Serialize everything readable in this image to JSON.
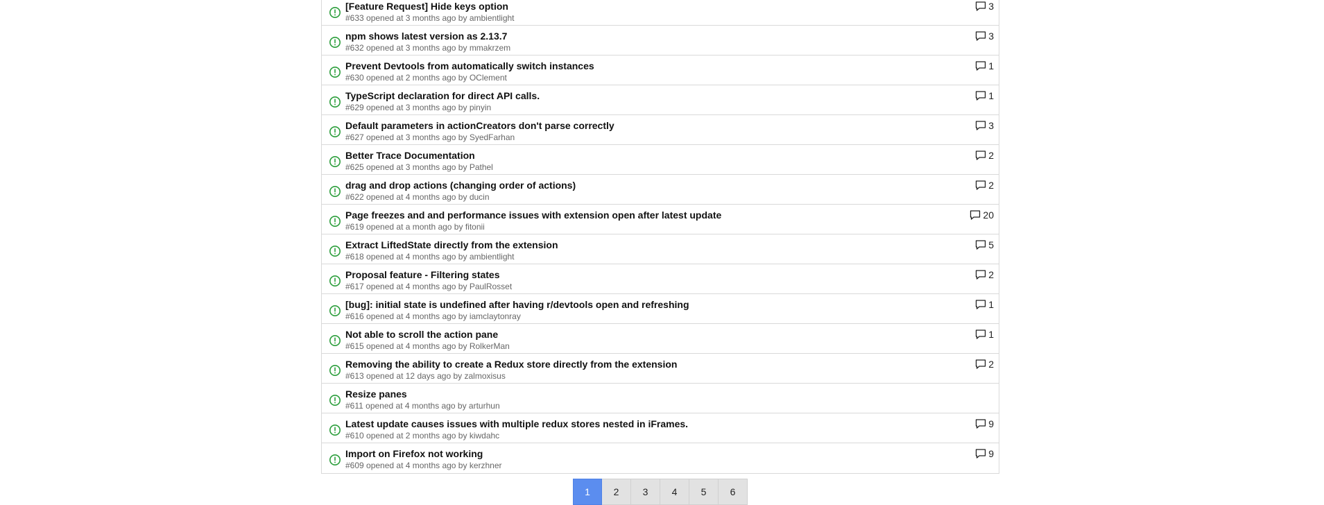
{
  "colors": {
    "open_icon": "#2a9d3a",
    "active_page": "#5b8def",
    "page_bg": "#e2e2e2"
  },
  "icons": {
    "status": "issue-opened-icon",
    "comments": "comment-icon"
  },
  "issues": [
    {
      "title": "[Feature Request] Hide keys option",
      "number": "#633",
      "opened": " opened at 3 months ago by ",
      "author": "ambientlight",
      "comments": "3"
    },
    {
      "title": "npm shows latest version as 2.13.7",
      "number": "#632",
      "opened": " opened at 3 months ago by ",
      "author": "mmakrzem",
      "comments": "3"
    },
    {
      "title": "Prevent Devtools from automatically switch instances",
      "number": "#630",
      "opened": " opened at 2 months ago by ",
      "author": "OClement",
      "comments": "1"
    },
    {
      "title": "TypeScript declaration for direct API calls.",
      "number": "#629",
      "opened": " opened at 3 months ago by ",
      "author": "pinyin",
      "comments": "1"
    },
    {
      "title": "Default parameters in actionCreators don't parse correctly",
      "number": "#627",
      "opened": " opened at 3 months ago by ",
      "author": "SyedFarhan",
      "comments": "3"
    },
    {
      "title": "Better Trace Documentation",
      "number": "#625",
      "opened": " opened at 3 months ago by ",
      "author": "Pathel",
      "comments": "2"
    },
    {
      "title": "drag and drop actions (changing order of actions)",
      "number": "#622",
      "opened": " opened at 4 months ago by ",
      "author": "ducin",
      "comments": "2"
    },
    {
      "title": "Page freezes and and performance issues with extension open after latest update",
      "number": "#619",
      "opened": " opened at a month ago by ",
      "author": "fitonii",
      "comments": "20"
    },
    {
      "title": "Extract LiftedState directly from the extension",
      "number": "#618",
      "opened": " opened at 4 months ago by ",
      "author": "ambientlight",
      "comments": "5"
    },
    {
      "title": "Proposal feature - Filtering states",
      "number": "#617",
      "opened": " opened at 4 months ago by ",
      "author": "PaulRosset",
      "comments": "2"
    },
    {
      "title": "[bug]: initial state is undefined after having r/devtools open and refreshing",
      "number": "#616",
      "opened": " opened at 4 months ago by ",
      "author": "iamclaytonray",
      "comments": "1"
    },
    {
      "title": "Not able to scroll the action pane",
      "number": "#615",
      "opened": " opened at 4 months ago by ",
      "author": "RolkerMan",
      "comments": "1"
    },
    {
      "title": "Removing the ability to create a Redux store directly from the extension",
      "number": "#613",
      "opened": " opened at 12 days ago by ",
      "author": "zalmoxisus",
      "comments": "2"
    },
    {
      "title": "Resize panes",
      "number": "#611",
      "opened": " opened at 4 months ago by ",
      "author": "arturhun",
      "comments": ""
    },
    {
      "title": "Latest update causes issues with multiple redux stores nested in iFrames.",
      "number": "#610",
      "opened": " opened at 2 months ago by ",
      "author": "kiwdahc",
      "comments": "9"
    },
    {
      "title": "Import on Firefox not working",
      "number": "#609",
      "opened": " opened at 4 months ago by ",
      "author": "kerzhner",
      "comments": "9"
    }
  ],
  "pagination": {
    "pages": [
      "1",
      "2",
      "3",
      "4",
      "5",
      "6"
    ],
    "current": "1"
  }
}
